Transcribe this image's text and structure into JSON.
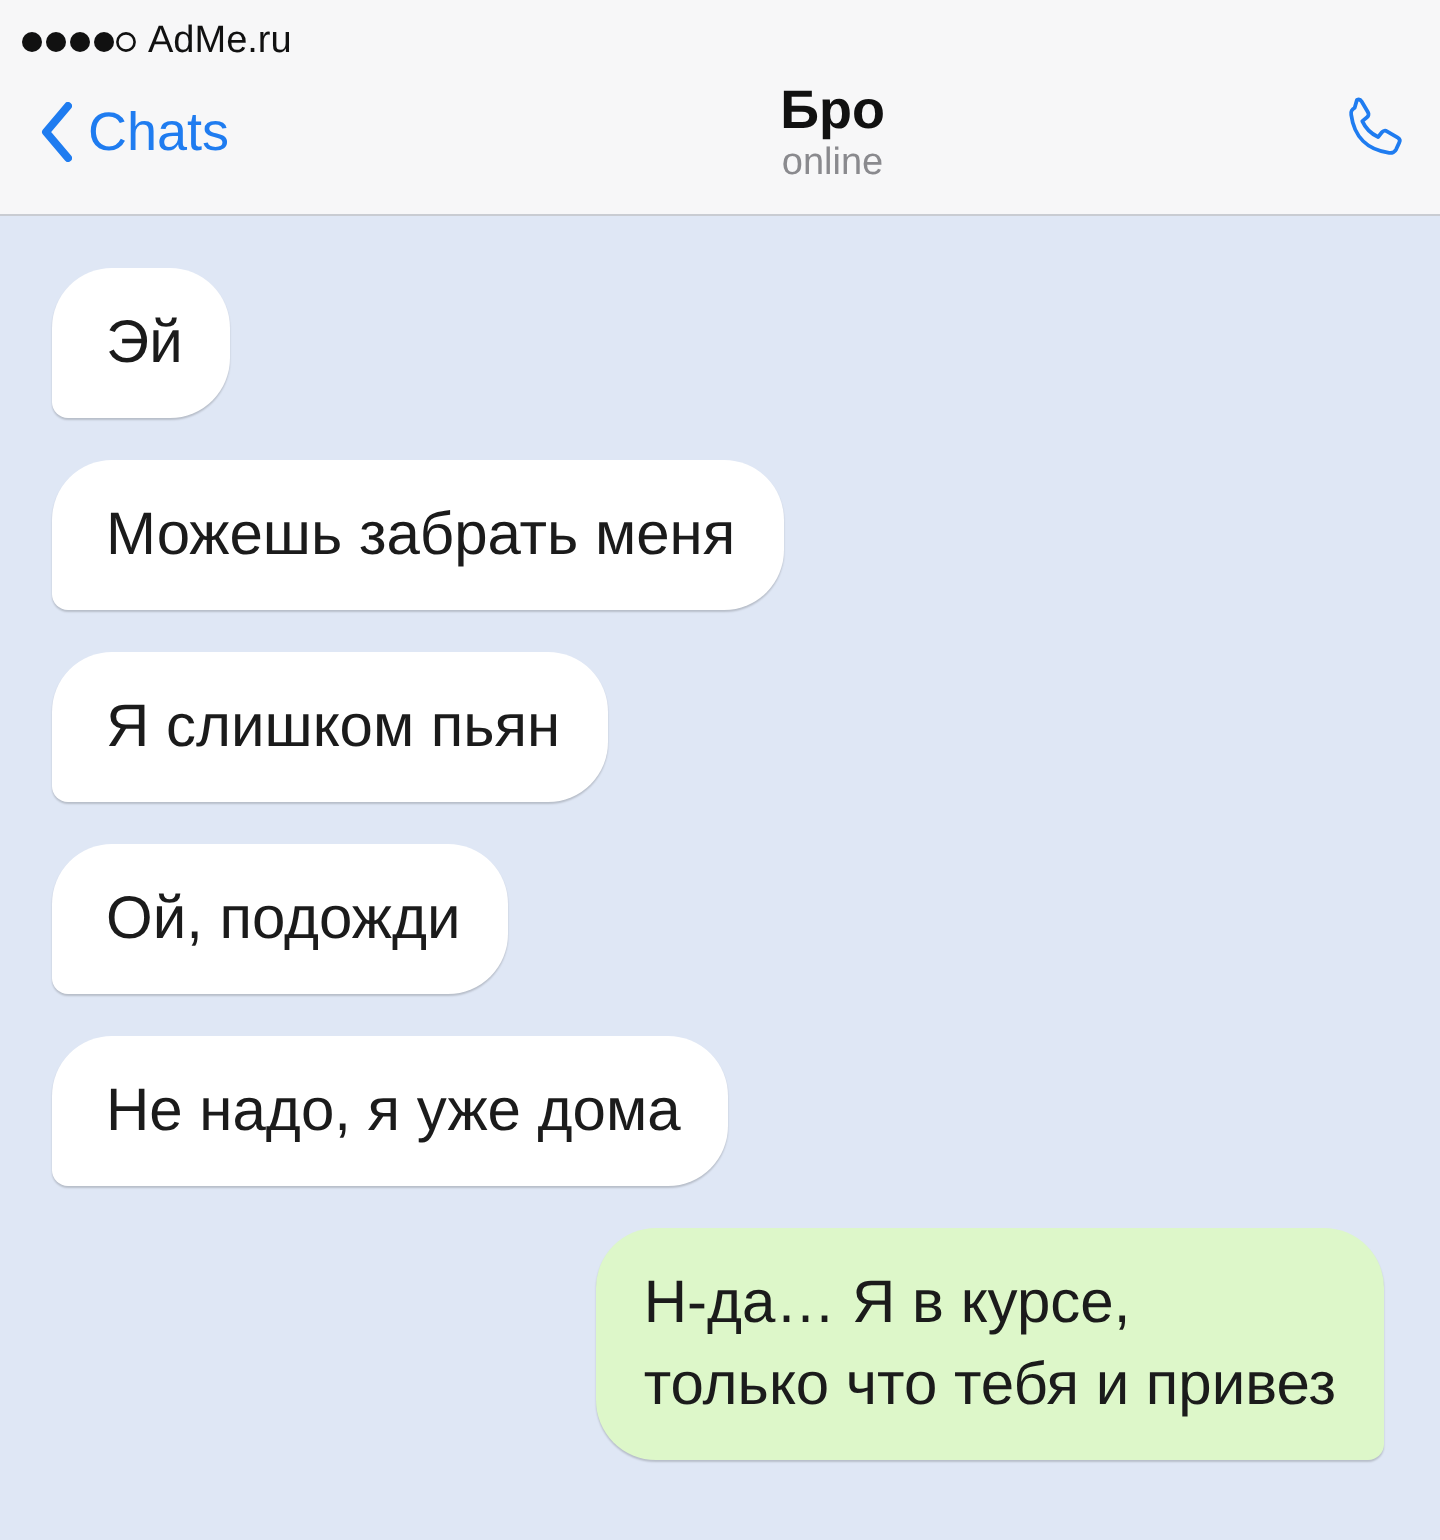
{
  "status_bar": {
    "carrier": "AdMe.ru"
  },
  "header": {
    "back_label": "Chats",
    "title": "Бро",
    "subtitle": "online"
  },
  "messages": [
    {
      "kind": "incoming",
      "text": "Эй"
    },
    {
      "kind": "incoming",
      "text": "Можешь забрать меня"
    },
    {
      "kind": "incoming",
      "text": "Я слишком пьян"
    },
    {
      "kind": "incoming",
      "text": "Ой, подожди"
    },
    {
      "kind": "incoming",
      "text": "Не надо, я уже дома"
    },
    {
      "kind": "outgoing",
      "text": "Н-да… Я в курсе,\nтолько что тебя и привез"
    }
  ]
}
